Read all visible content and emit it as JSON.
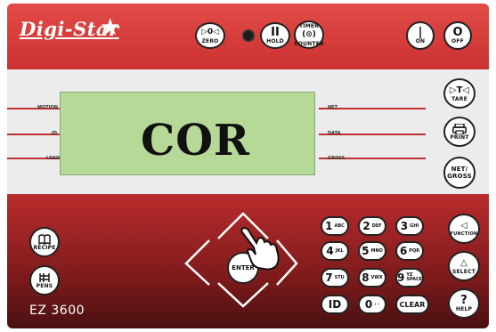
{
  "brand": {
    "name": "Digi-Star",
    "star": "★"
  },
  "top_buttons": {
    "zero": {
      "glyph": "▷0◁",
      "label": "ZERO"
    },
    "hold": {
      "glyph": "II",
      "label": "HOLD"
    },
    "timer_counter": {
      "glyph": "(⊙)",
      "label_top": "TIMER",
      "label": "COUNTER"
    },
    "on": {
      "glyph": "|",
      "label": "ON"
    },
    "off": {
      "glyph": "O",
      "label": "OFF"
    }
  },
  "display": {
    "text": "COR",
    "left_labels": [
      "MOTION",
      "ID",
      "LOAD"
    ],
    "right_labels": [
      "NET",
      "DATA",
      "GROSS"
    ]
  },
  "side_buttons": {
    "tare": {
      "glyph": "▷T◁",
      "label": "TARE"
    },
    "print": {
      "label": "PRINT"
    },
    "net_gross": {
      "label": "NET/ GROSS"
    }
  },
  "left_buttons": {
    "recipe": {
      "label": "RECIPE"
    },
    "pens": {
      "label": "PENS"
    }
  },
  "nav": {
    "enter_label": "ENTER"
  },
  "keypad": [
    {
      "key": "1",
      "sub": "ABC"
    },
    {
      "key": "2",
      "sub": "DEF"
    },
    {
      "key": "3",
      "sub": "GHI"
    },
    {
      "key": "4",
      "sub": "JKL"
    },
    {
      "key": "5",
      "sub": "MNO"
    },
    {
      "key": "6",
      "sub": "PQR"
    },
    {
      "key": "7",
      "sub": "STU"
    },
    {
      "key": "8",
      "sub": "VWX"
    },
    {
      "key": "9",
      "sub": "YZ SPACE"
    },
    {
      "key": "ID",
      "sub": ""
    },
    {
      "key": "0",
      "sub": ": -"
    },
    {
      "key": "CLEAR",
      "sub": ""
    }
  ],
  "right_buttons": {
    "function": {
      "glyph": "◁",
      "label": "FUNCTION"
    },
    "select": {
      "glyph": "△",
      "label": "SELECT"
    },
    "help": {
      "glyph": "?",
      "label": "HELP"
    }
  },
  "model": "EZ 3600"
}
